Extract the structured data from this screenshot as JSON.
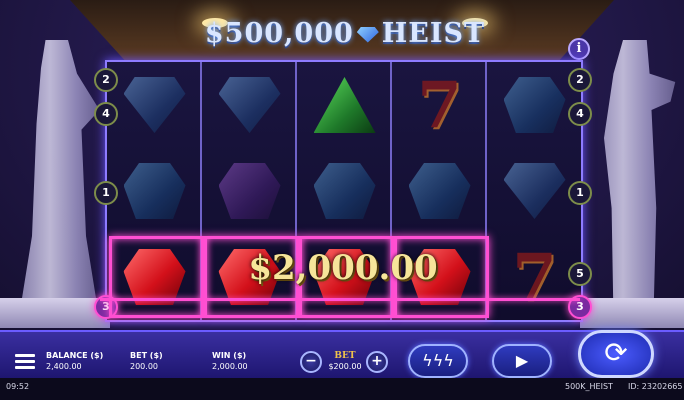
{
  "title": {
    "left": "$500,000",
    "right": "HEIST"
  },
  "info_label": "i",
  "left_badges": [
    "2",
    "4",
    "1",
    "3"
  ],
  "right_badges": [
    "2",
    "4",
    "1",
    "5",
    "3"
  ],
  "left_active_badge": "3",
  "reels": [
    [
      "gem-blue",
      "gem-blue-hex",
      "ruby"
    ],
    [
      "gem-blue",
      "gem-purple",
      "ruby"
    ],
    [
      "gem-green",
      "gem-blue-hex",
      "ruby"
    ],
    [
      "seven",
      "gem-blue-hex",
      "ruby"
    ],
    [
      "gem-blue-hex",
      "gem-blue",
      "seven"
    ]
  ],
  "win_amount": "$2,000.00",
  "panel": {
    "balance_label": "BALANCE ($)",
    "balance_value": "2,400.00",
    "bet_label": "BET ($)",
    "bet_value": "200.00",
    "win_label": "WIN ($)",
    "win_value": "2,000.00",
    "bet_control_label": "BET",
    "bet_control_value": "$200.00",
    "minus": "−",
    "plus": "+",
    "turbo": "ϟϟϟ",
    "autoplay": "▶",
    "spin": "⟳"
  },
  "footer": {
    "time": "09:52",
    "game": "500K_HEIST",
    "id": "ID: 23202665"
  },
  "colors": {
    "win_line": "#ff4fd2",
    "panel": "#2a2090",
    "accent": "#9fb2ff"
  }
}
